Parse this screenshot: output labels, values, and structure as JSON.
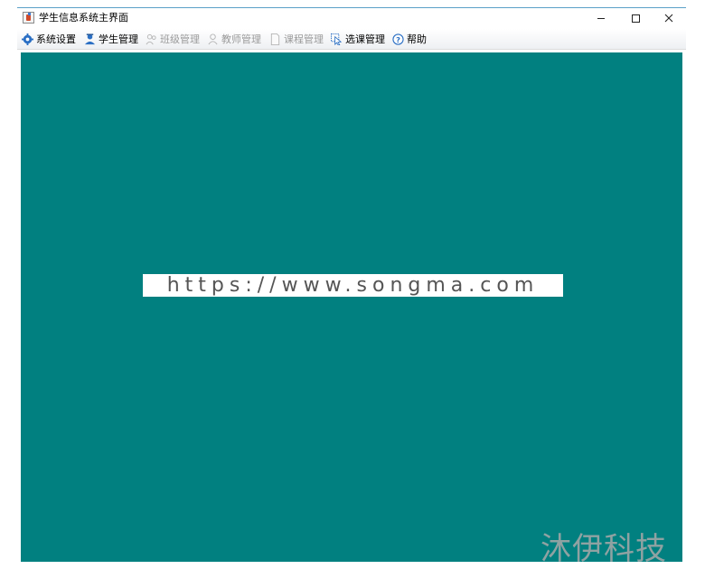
{
  "window": {
    "title": "学生信息系统主界面"
  },
  "menu": {
    "items": [
      {
        "label": "系统设置",
        "icon": "gear-icon",
        "enabled": true
      },
      {
        "label": "学生管理",
        "icon": "student-icon",
        "enabled": true
      },
      {
        "label": "班级管理",
        "icon": "class-icon",
        "enabled": false
      },
      {
        "label": "教师管理",
        "icon": "teacher-icon",
        "enabled": false
      },
      {
        "label": "课程管理",
        "icon": "document-icon",
        "enabled": false
      },
      {
        "label": "选课管理",
        "icon": "cursor-select-icon",
        "enabled": true
      },
      {
        "label": "帮助",
        "icon": "help-icon",
        "enabled": true
      }
    ]
  },
  "content": {
    "background": "#018080",
    "banner_text": "https://www.songma.com"
  },
  "watermark": {
    "text": "沐伊科技"
  }
}
